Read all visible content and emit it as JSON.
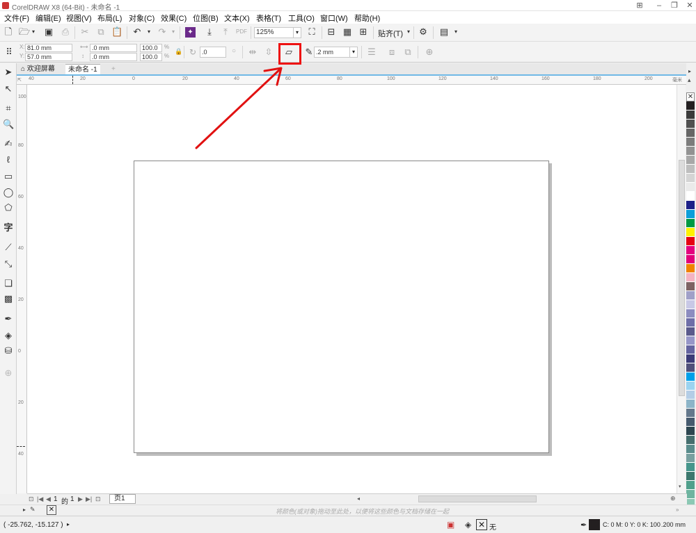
{
  "window": {
    "title": "CorelDRAW X8 (64-Bit) - 未命名 -1"
  },
  "menu": [
    "文件(F)",
    "编辑(E)",
    "视图(V)",
    "布局(L)",
    "对象(C)",
    "效果(C)",
    "位图(B)",
    "文本(X)",
    "表格(T)",
    "工具(O)",
    "窗口(W)",
    "帮助(H)"
  ],
  "standard_toolbar": {
    "zoom_value": "125%",
    "snap_label": "贴齐(T)"
  },
  "property_bar": {
    "x": "81.0 mm",
    "y": "57.0 mm",
    "width": ".0 mm",
    "height": ".0 mm",
    "scale_x": "100.0",
    "scale_y": "100.0",
    "percent": "%",
    "rotation": ".0",
    "outline_width": ".2 mm"
  },
  "tabs": [
    {
      "label": "欢迎屏幕"
    },
    {
      "label": "未命名 -1"
    }
  ],
  "ruler": {
    "h_ticks": [
      "40",
      "20",
      "0",
      "20",
      "40",
      "60",
      "80",
      "100",
      "120",
      "140",
      "160",
      "180",
      "200"
    ],
    "unit": "毫米",
    "v_ticks": [
      "100",
      "80",
      "60",
      "40",
      "20",
      "0",
      "20",
      "40"
    ]
  },
  "page_nav": {
    "current": "1",
    "of": "的",
    "total": "1",
    "page_tab": "页1"
  },
  "doc_palette_hint": "将颜色(或对象)拖动至此处，以便将这些颜色与文档存储在一起",
  "status": {
    "coords": "( -25.762, -15.127 )",
    "fill_label": "无",
    "color_info": "C: 0 M: 0 Y: 0 K: 100",
    "outline_size": ".200 mm"
  },
  "palette_colors": [
    "#231f20",
    "#3a3a3a",
    "#505050",
    "#666666",
    "#7c7c7c",
    "#929292",
    "#a8a8a8",
    "#bebebe",
    "#d4d4d4",
    "#eaeaea",
    "#ffffff",
    "#1d2088",
    "#0b9ed9",
    "#009944",
    "#fff100",
    "#e60012",
    "#e4007f",
    "#e2007a",
    "#f08300",
    "#f4b3c2",
    "#7d6363",
    "#a0a0c8",
    "#c8c8e6",
    "#8c8cc0",
    "#6e6ea8",
    "#5a5a8c",
    "#9696c8",
    "#6464a0",
    "#3c3c78",
    "#50507a",
    "#00a0e9",
    "#9bd3f0",
    "#b4cde6",
    "#8cb4c8",
    "#64788c",
    "#465a6e",
    "#2d4650",
    "#466e6e",
    "#5a8c8c",
    "#78a0a0",
    "#46968c",
    "#3c786e",
    "#50a08c",
    "#6eb4a0",
    "#8cc8b4",
    "#2ea7b8",
    "#4fbcc8"
  ],
  "colors": {
    "accent": "#e11111",
    "ruler_line": "#6fb9e6"
  }
}
